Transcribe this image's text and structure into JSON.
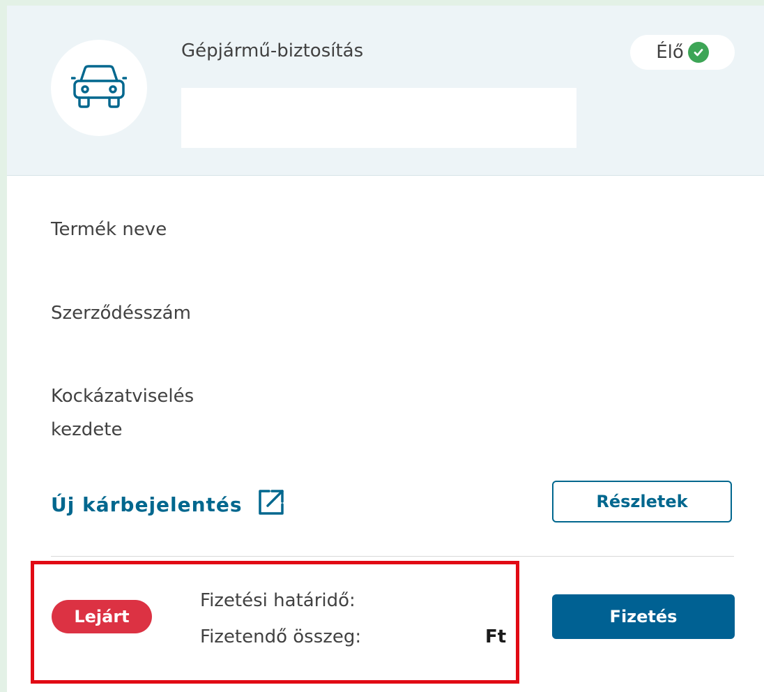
{
  "header": {
    "icon": "car-icon",
    "title": "Gépjármű-biztosítás",
    "status_label": "Élő",
    "status_icon": "check-circle-icon",
    "status_color": "#3da556"
  },
  "fields": {
    "product_name_label": "Termék neve",
    "contract_number_label": "Szerződésszám",
    "coverage_start_label_line1": "Kockázatviselés",
    "coverage_start_label_line2": "kezdete"
  },
  "actions": {
    "new_claim_link": "Új kárbejelentés",
    "new_claim_icon": "external-link-icon",
    "details_button": "Részletek"
  },
  "payment": {
    "status_badge": "Lejárt",
    "deadline_label": "Fizetési határidő:",
    "amount_label": "Fizetendő összeg:",
    "currency": "Ft",
    "pay_button": "Fizetés"
  },
  "colors": {
    "accent": "#00678e",
    "pay_button": "#006193",
    "expired": "#dc3243",
    "highlight_border": "#e10a14",
    "header_bg": "#edf4f7"
  }
}
